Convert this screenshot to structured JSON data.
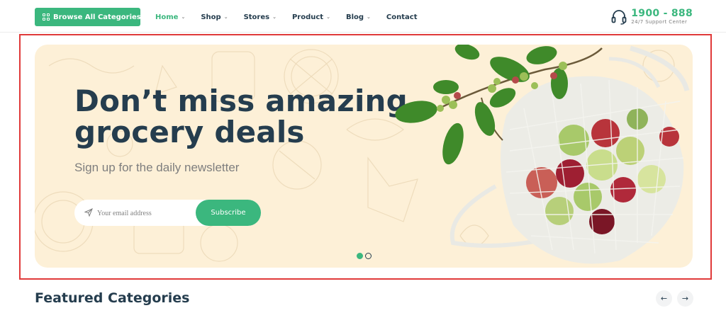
{
  "header": {
    "browse_label": "Browse  All Categories",
    "nav": [
      {
        "label": "Home",
        "has_dropdown": true,
        "active": true
      },
      {
        "label": "Shop",
        "has_dropdown": true
      },
      {
        "label": "Stores",
        "has_dropdown": true
      },
      {
        "label": "Product",
        "has_dropdown": true
      },
      {
        "label": "Blog",
        "has_dropdown": true
      },
      {
        "label": "Contact",
        "has_dropdown": false
      }
    ],
    "support_phone": "1900 - 888",
    "support_sub": "24/7 Support Center",
    "icons": {
      "browse": "grid-icon",
      "dropdown": "chevron-down-icon",
      "support": "headset-icon"
    }
  },
  "hero": {
    "title_line1": "Don’t miss amazing",
    "title_line2": "grocery deals",
    "subtitle": "Sign up for the daily newsletter",
    "email_placeholder": "Your email address",
    "subscribe_label": "Subscribe",
    "slides_total": 2,
    "active_slide": 1,
    "background_color": "#fdf0d7",
    "accent_color": "#3bb77e",
    "image": "apples-in-net-bag"
  },
  "featured": {
    "title": "Featured Categories",
    "prev_icon": "arrow-left-icon",
    "next_icon": "arrow-right-icon"
  },
  "colors": {
    "brand_green": "#3bb77e",
    "heading": "#253d4e",
    "muted": "#7e7e7e",
    "highlight_border": "#e03a3a"
  }
}
